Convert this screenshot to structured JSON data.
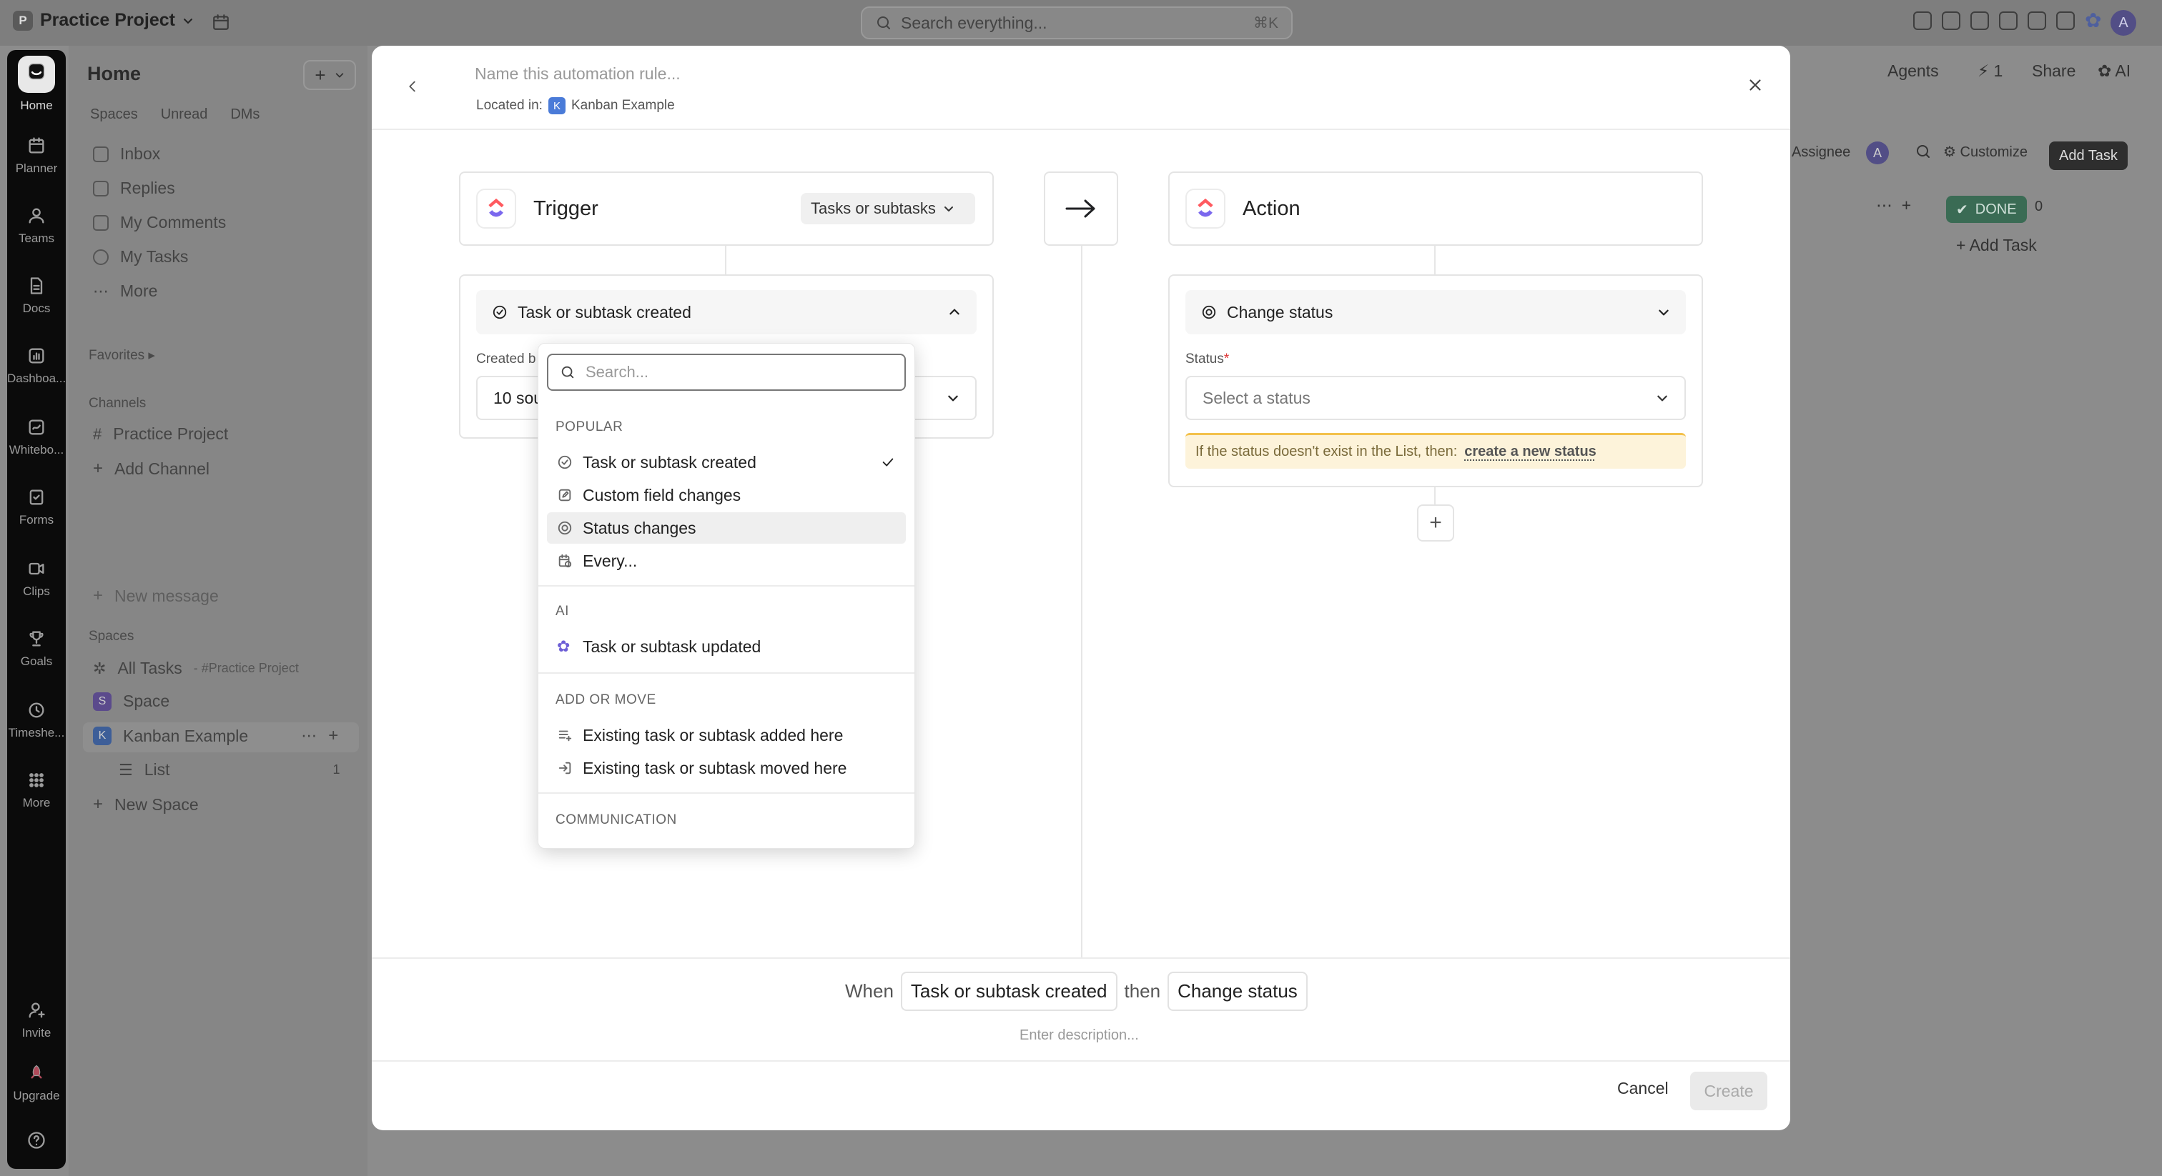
{
  "topbar": {
    "project": "Practice Project",
    "project_initial": "P",
    "search_placeholder": "Search everything...",
    "search_shortcut": "⌘K",
    "avatar": "A"
  },
  "rail": {
    "items": [
      "Home",
      "Planner",
      "Teams",
      "Docs",
      "Dashboa...",
      "Whitebo...",
      "Forms",
      "Clips",
      "Goals",
      "Timeshe...",
      "More"
    ],
    "bottom": [
      "Invite",
      "Upgrade"
    ]
  },
  "sidebar": {
    "title": "Home",
    "tabs": [
      "Spaces",
      "Unread",
      "DMs"
    ],
    "nav": [
      "Inbox",
      "Replies",
      "My Comments",
      "My Tasks",
      "More"
    ],
    "favorites": "Favorites",
    "channels_title": "Channels",
    "channels": [
      "Practice Project"
    ],
    "add_channel": "Add Channel",
    "new_message": "New message",
    "spaces_title": "Spaces",
    "all_tasks": "All Tasks",
    "all_tasks_sub": "- #Practice Project",
    "space": "Space",
    "space_initial": "S",
    "kanban": "Kanban Example",
    "kanban_initial": "K",
    "list": "List",
    "list_count": "1",
    "new_space": "New Space"
  },
  "background": {
    "agents": "Agents",
    "count": "1",
    "share": "Share",
    "ai": "AI",
    "assignee": "Assignee",
    "assignee_avatar": "A",
    "customize": "Customize",
    "add_task_btn": "Add Task",
    "done": "DONE",
    "done_count": "0",
    "add_task_link": "Add Task"
  },
  "modal": {
    "name_placeholder": "Name this automation rule...",
    "located_in": "Located in:",
    "location": "Kanban Example",
    "location_initial": "K",
    "trigger": {
      "title": "Trigger",
      "scope": "Tasks or subtasks",
      "selected": "Task or subtask created",
      "created_by_label": "Created b",
      "sources": "10 sou"
    },
    "action": {
      "title": "Action",
      "selected": "Change status",
      "status_label": "Status",
      "status_required": "*",
      "status_placeholder": "Select a status",
      "warning": "If the status doesn't exist in the List, then:",
      "warning_link": "create a new status"
    },
    "add_step": "+",
    "summary": {
      "when": "When",
      "trigger_chip": "Task or subtask created",
      "then": "then",
      "action_chip": "Change status",
      "description_placeholder": "Enter description..."
    },
    "footer": {
      "cancel": "Cancel",
      "create": "Create"
    }
  },
  "dropdown": {
    "search_placeholder": "Search...",
    "sections": [
      {
        "title": "POPULAR",
        "items": [
          "Task or subtask created",
          "Custom field changes",
          "Status changes",
          "Every..."
        ]
      },
      {
        "title": "AI",
        "items": [
          "Task or subtask updated"
        ]
      },
      {
        "title": "ADD OR MOVE",
        "items": [
          "Existing task or subtask added here",
          "Existing task or subtask moved here"
        ]
      },
      {
        "title": "COMMUNICATION",
        "items": []
      }
    ],
    "checked_item": "Task or subtask created",
    "highlighted_item": "Status changes"
  },
  "colors": {
    "accent": "#4a7bd8",
    "done": "#3a6b54",
    "warning_bg": "#fdf3da",
    "overlay": "#8c8c8c"
  }
}
